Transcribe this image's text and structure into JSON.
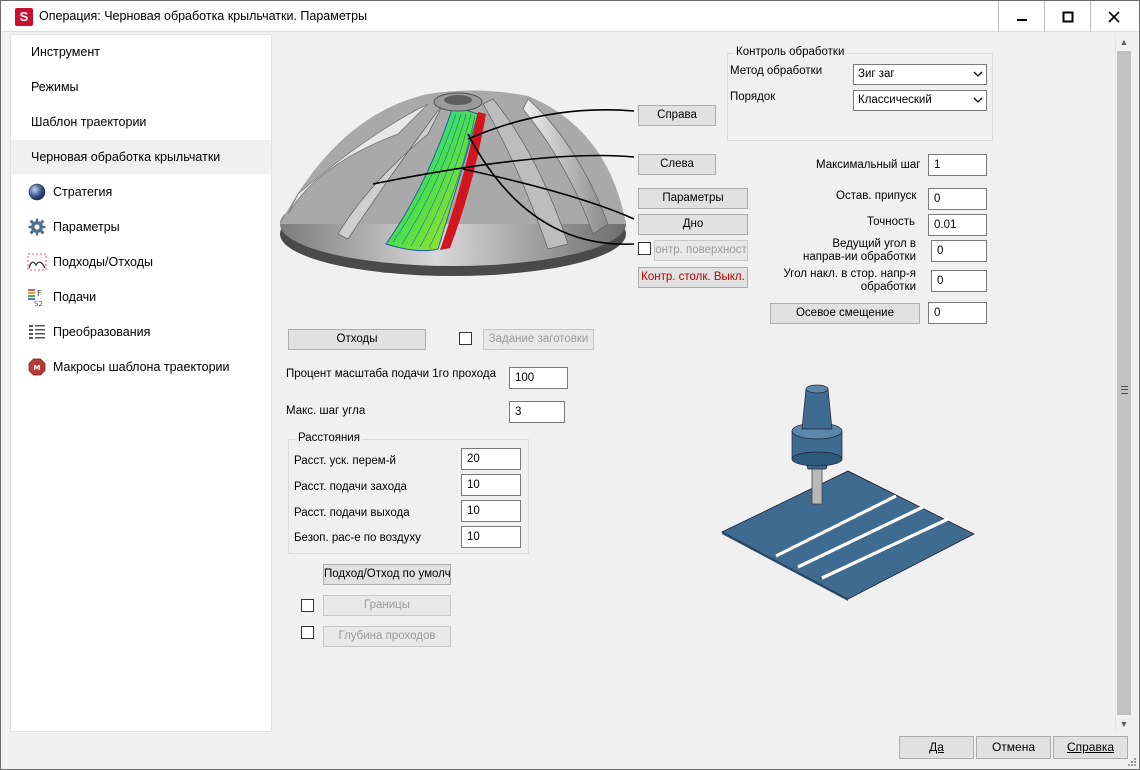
{
  "window": {
    "title": "Операция: Черновая обработка крыльчатки. Параметры",
    "app_icon_letter": "S"
  },
  "sidebar": {
    "items": [
      {
        "label": "Инструмент",
        "icon": ""
      },
      {
        "label": "Режимы",
        "icon": ""
      },
      {
        "label": "Шаблон траектории",
        "icon": ""
      },
      {
        "label": "Черновая обработка крыльчатки",
        "icon": "",
        "active": true
      },
      {
        "label": "Стратегия",
        "icon": "sphere-icon"
      },
      {
        "label": "Параметры",
        "icon": "gear-icon"
      },
      {
        "label": "Подходы/Отходы",
        "icon": "approach-icon"
      },
      {
        "label": "Подачи",
        "icon": "feed-icon"
      },
      {
        "label": "Преобразования",
        "icon": "transform-icon"
      },
      {
        "label": "Макросы шаблона траектории",
        "icon": "macro-icon"
      }
    ]
  },
  "diagram_buttons": {
    "right": "Справа",
    "left": "Слева",
    "params": "Параметры",
    "bottom": "Дно",
    "surface_check": "онтр. поверхност",
    "collision": "Контр. столк. Выкл."
  },
  "control": {
    "group_title": "Контроль обработки",
    "method_label": "Метод обработки",
    "method_value": "Зиг заг",
    "order_label": "Порядок",
    "order_value": "Классический"
  },
  "params": {
    "max_step_label": "Максимальный шаг",
    "max_step_value": "1",
    "allowance_label": "Остав. припуск",
    "allowance_value": "0",
    "accuracy_label": "Точность",
    "accuracy_value": "0.01",
    "lead_angle_label_1": "Ведущий угол в",
    "lead_angle_label_2": "направ-ии обработки",
    "lead_angle_value": "0",
    "tilt_angle_label_1": "Угол накл. в стор. напр-я",
    "tilt_angle_label_2": "обработки",
    "tilt_angle_value": "0",
    "axial_offset_button": "Осевое смещение",
    "axial_offset_value": "0"
  },
  "retracts_button": "Отходы",
  "stock_button": "Задание заготовки",
  "feed_scale_label": "Процент масштаба подачи 1го прохода",
  "feed_scale_value": "100",
  "max_angle_step_label": "Макс. шаг угла",
  "max_angle_step_value": "3",
  "distances": {
    "group_title": "Расстояния",
    "rapid_label": "Расст. уск. перем-й",
    "rapid_value": "20",
    "approach_feed_label": "Расст. подачи захода",
    "approach_feed_value": "10",
    "exit_feed_label": "Расст. подачи выхода",
    "exit_feed_value": "10",
    "safe_air_label": "Безоп. рас-е по воздуху",
    "safe_air_value": "10"
  },
  "default_approach_button": "Подход/Отход по умолч.",
  "bounds_button": "Границы",
  "depth_button": "Глубина проходов",
  "footer": {
    "ok": "Да",
    "cancel": "Отмена",
    "help": "Справка"
  },
  "colors": {
    "accent_red": "#c8102e",
    "tool_blue": "#3e6b8f"
  }
}
